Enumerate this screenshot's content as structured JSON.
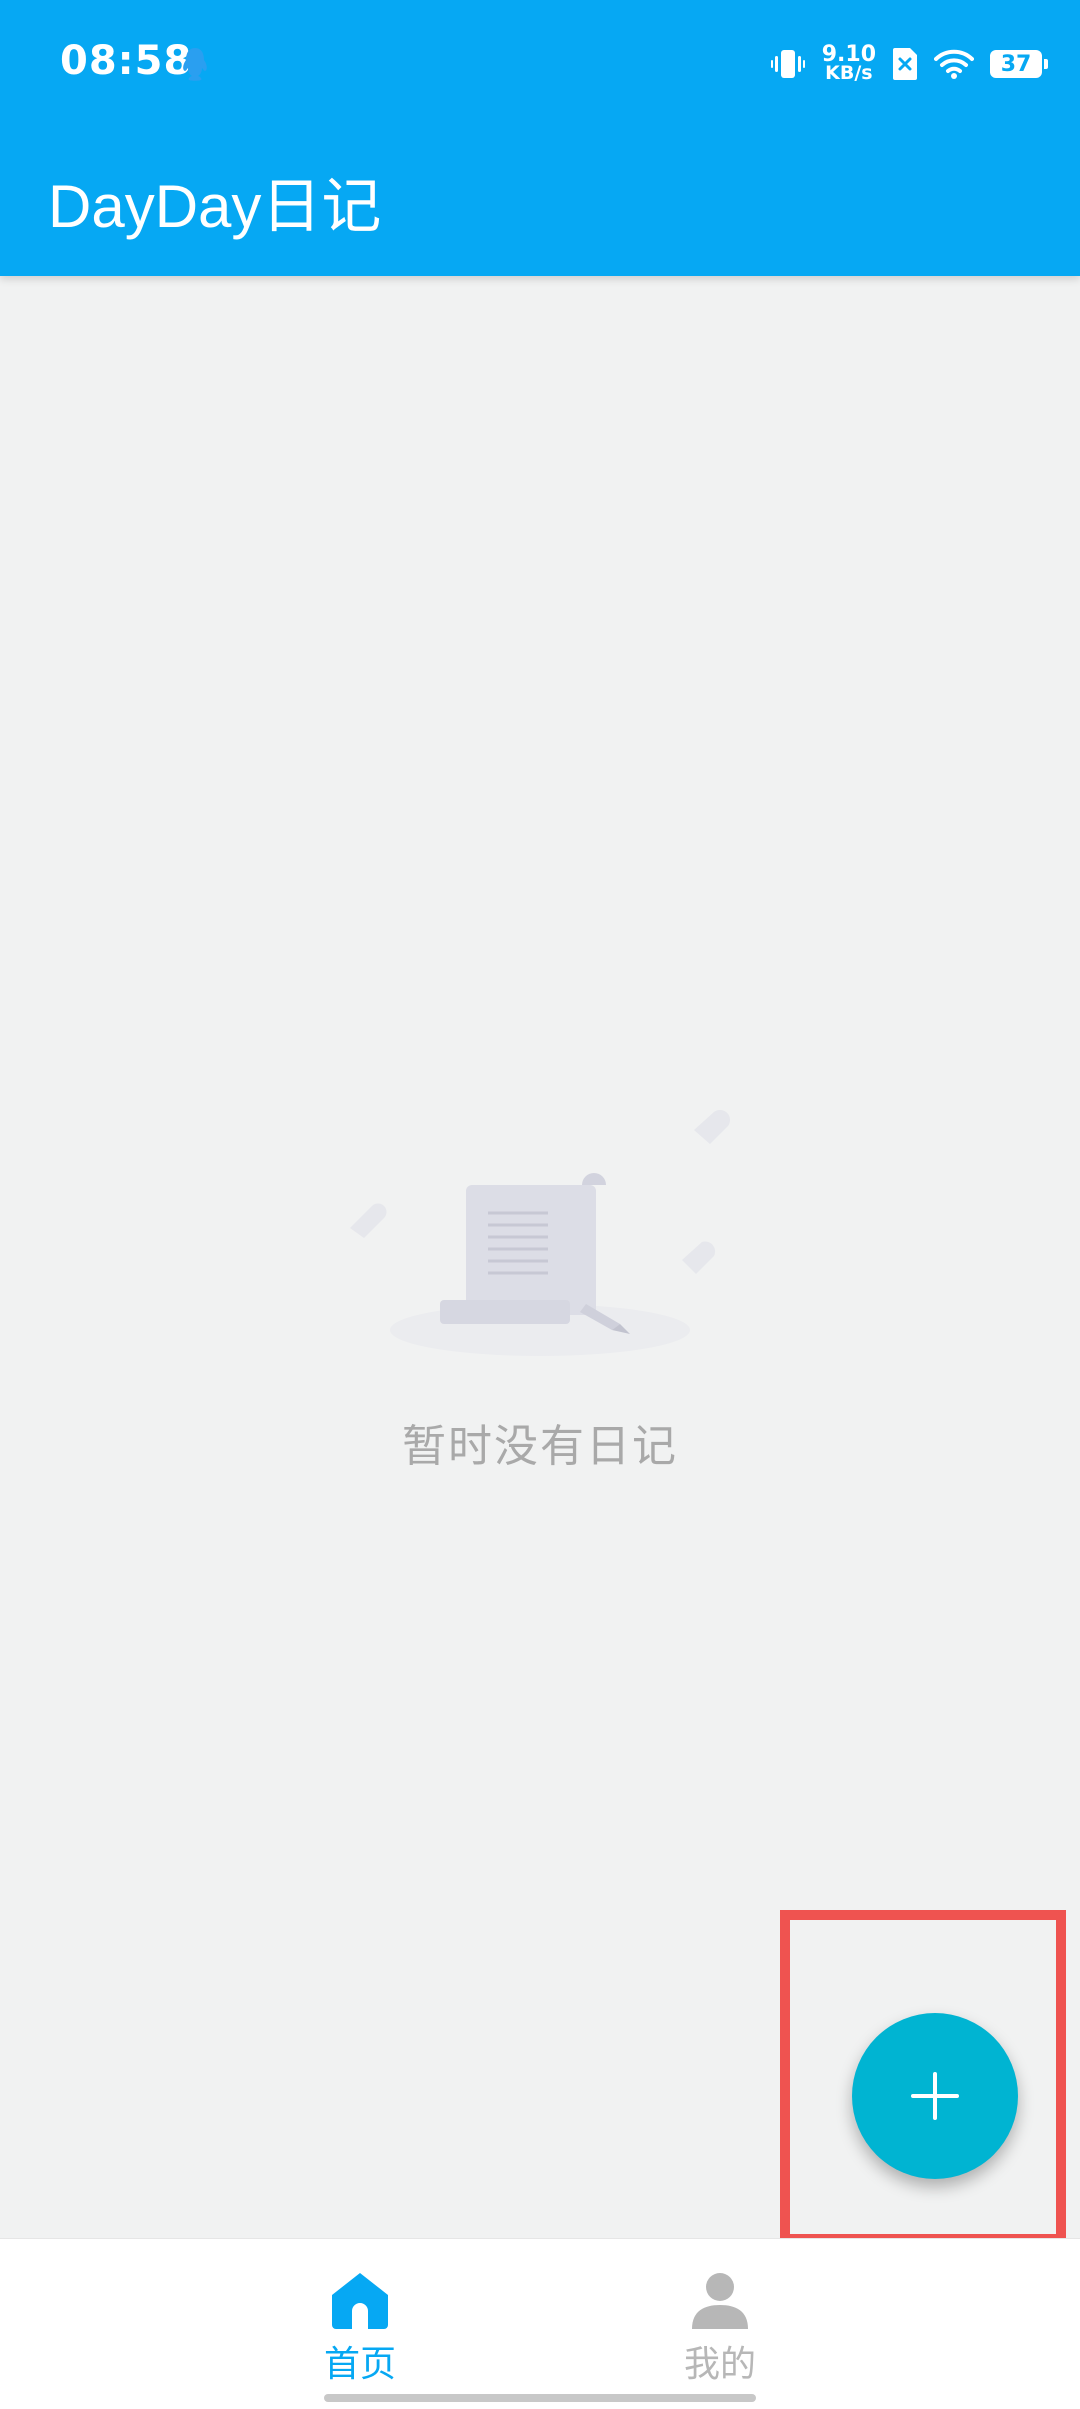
{
  "status_bar": {
    "time": "08:58",
    "net_speed_value": "9.10",
    "net_speed_unit": "KB/s",
    "battery_level": "37"
  },
  "app_bar": {
    "title": "DayDay日记"
  },
  "empty_state": {
    "message": "暂时没有日记"
  },
  "fab": {
    "icon": "plus-icon"
  },
  "bottom_nav": {
    "items": [
      {
        "label": "首页",
        "icon": "home-icon",
        "active": true
      },
      {
        "label": "我的",
        "icon": "person-icon",
        "active": false
      }
    ]
  },
  "colors": {
    "primary": "#06a8f3",
    "fab": "#00b4d2",
    "highlight": "#ef5350",
    "inactive": "#b7b7b7"
  }
}
